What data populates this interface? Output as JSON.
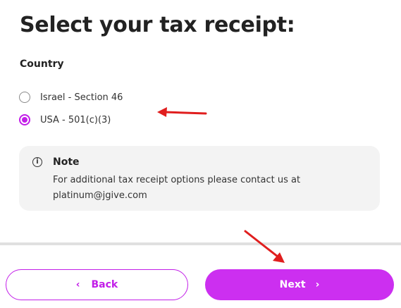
{
  "page": {
    "title": "Select your tax receipt:",
    "section_label": "Country"
  },
  "options": [
    {
      "label": "Israel - Section 46",
      "selected": false
    },
    {
      "label": "USA - 501(c)(3)",
      "selected": true
    }
  ],
  "note": {
    "icon": "info-icon",
    "icon_glyph": "i",
    "title": "Note",
    "text": "For additional tax receipt options please contact us at platinum@jgive.com"
  },
  "buttons": {
    "back_label": "Back",
    "back_icon": "chevron-left-icon",
    "back_glyph": "‹",
    "next_label": "Next",
    "next_icon": "chevron-right-icon",
    "next_glyph": "›"
  },
  "colors": {
    "accent": "#c21ee8",
    "next_button": "#cc2ff0",
    "annotation_arrow": "#e01e1e",
    "note_background": "#f3f3f3"
  }
}
